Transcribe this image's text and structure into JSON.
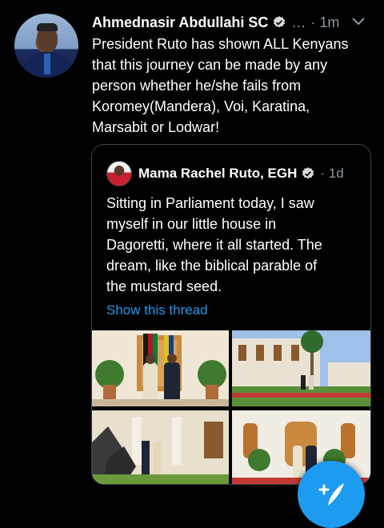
{
  "tweet": {
    "author": "Ahmednasir Abdullahi SC",
    "ellipsis": "…",
    "time": "· 1m",
    "lines": [
      "President Ruto has shown ALL Kenyans",
      "that this journey can be made by any",
      "person whether he/she fails from",
      "Koromey(Mandera), Voi, Karatina,",
      "Marsabit or Lodwar!"
    ]
  },
  "quote": {
    "author": "Mama Rachel Ruto, EGH",
    "time": "· 1d",
    "lines": [
      "Sitting in Parliament today, I saw",
      "myself in our little house in",
      "Dagoretti, where it all started. The",
      "dream, like the biblical parable of",
      "the mustard seed."
    ],
    "show_thread": "Show this thread"
  },
  "colors": {
    "background": "#000000",
    "secondary_text": "#8b98a5",
    "accent": "#1d9bf0",
    "border": "#38444d"
  },
  "icons": {
    "verified": "verified-badge-icon",
    "more": "chevron-down-icon",
    "compose": "compose-tweet-icon"
  }
}
